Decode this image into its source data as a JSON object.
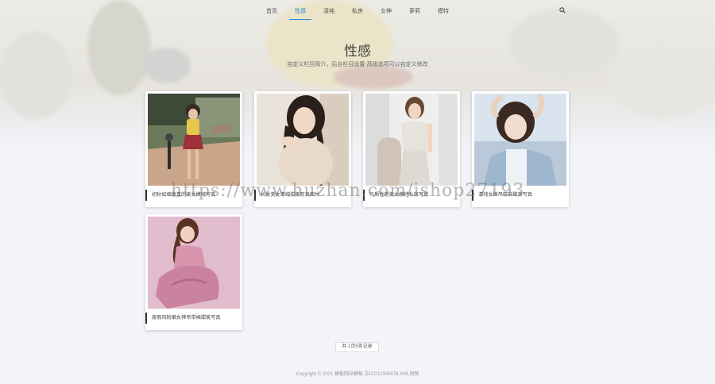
{
  "nav": {
    "items": [
      {
        "label": "首页"
      },
      {
        "label": "性感"
      },
      {
        "label": "清纯"
      },
      {
        "label": "私房"
      },
      {
        "label": "女神"
      },
      {
        "label": "萝莉"
      },
      {
        "label": "模特"
      }
    ],
    "active_index": 1,
    "search_icon": "search-icon"
  },
  "header": {
    "title": "性感",
    "description": "自定义栏目简介，后台栏目设置-高级选项可以自定义修改"
  },
  "cards": [
    {
      "caption": "初秋如烟氤氲的美女模特写真"
    },
    {
      "caption": "长发美女清纯甜美写真图片"
    },
    {
      "caption": "气质性感美女模特私房写真"
    },
    {
      "caption": "清纯女神吊带装甜美写真"
    },
    {
      "caption": "度假风粉嫩女神吊带裙甜美写真"
    }
  ],
  "pagination": {
    "label": "共 1页5条记录"
  },
  "footer": {
    "text": "Copyright © 2021 模板网站模板 苏ICP12345678 XML地图"
  },
  "watermark": {
    "text": "https://www.huzhan.com/ishop27193"
  },
  "colors": {
    "accent": "#2e86de",
    "background": "#f3f4f7"
  }
}
